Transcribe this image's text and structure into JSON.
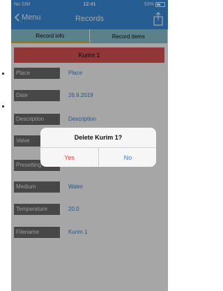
{
  "status": {
    "carrier": "No SIM",
    "time": "12:41",
    "battery": "53%"
  },
  "nav": {
    "back_label": "Menu",
    "title": "Records"
  },
  "tabs": [
    {
      "label": "Record info"
    },
    {
      "label": "Record items"
    }
  ],
  "record": {
    "title": "Kurim 1"
  },
  "fields": [
    {
      "label": "Place",
      "value": "Place"
    },
    {
      "label": "Date",
      "value": "26.9.2019"
    },
    {
      "label": "Description",
      "value": "Description"
    },
    {
      "label": "Valve",
      "value": ""
    },
    {
      "label": "Presetting",
      "value": ""
    },
    {
      "label": "Medium",
      "value": "Water"
    },
    {
      "label": "Temperature",
      "value": "20.0"
    },
    {
      "label": "Filename",
      "value": "Kurim 1"
    }
  ],
  "dialog": {
    "title": "Delete Kurim 1?",
    "yes_label": "Yes",
    "no_label": "No"
  },
  "colors": {
    "primary": "#3b8fe0",
    "tab": "#8cc6d4",
    "accent": "#f2b400",
    "record_header": "#e05555",
    "label_bg": "#6d6d6d",
    "value_text": "#3a86d6",
    "destructive": "#d9453a"
  }
}
